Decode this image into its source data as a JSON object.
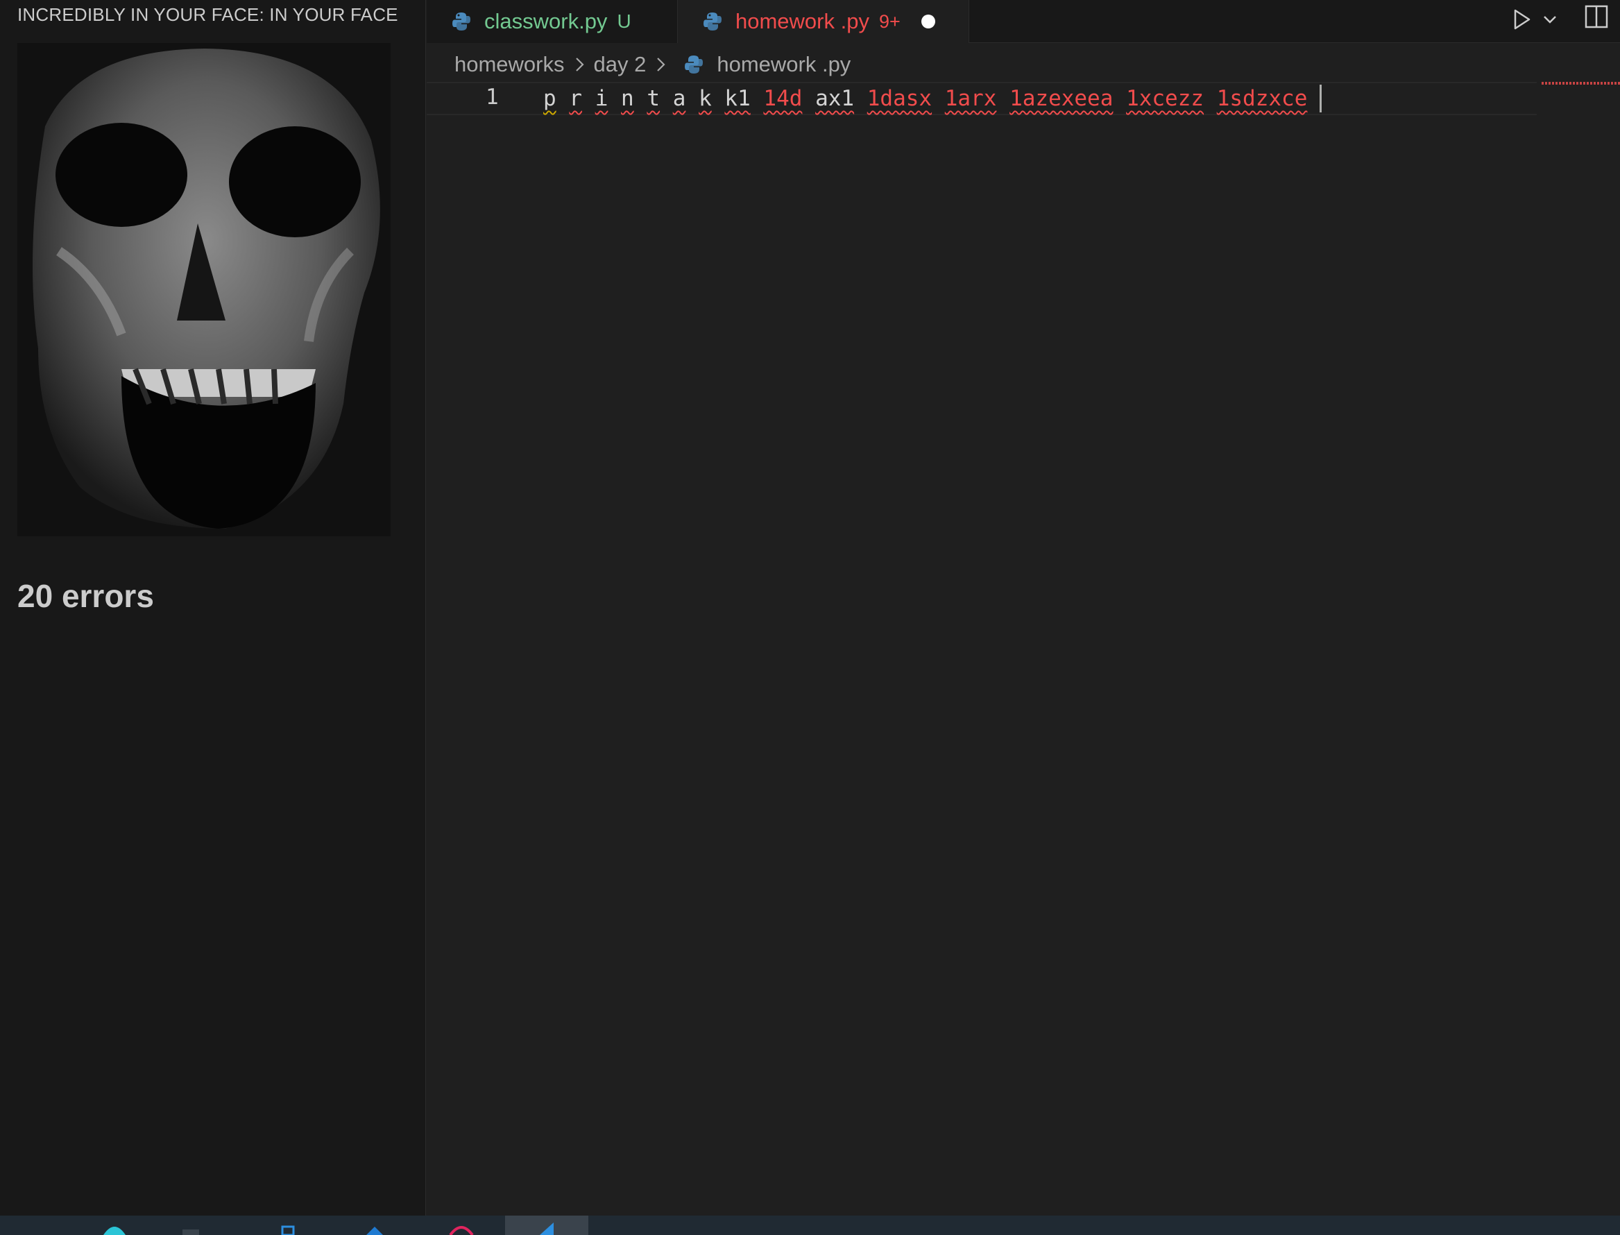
{
  "side_panel": {
    "title": "INCREDIBLY IN YOUR FACE: IN YOUR FACE",
    "image_icon": "skull-image",
    "errors_text": "20 errors"
  },
  "tabs": [
    {
      "label": "classwork.py",
      "badge": "U",
      "icon": "python-icon",
      "state": "inactive"
    },
    {
      "label": "homework .py",
      "badge": "9+",
      "icon": "python-icon",
      "state": "active",
      "dirty": true
    }
  ],
  "toolbar": {
    "run_icon": "play-icon",
    "dropdown_icon": "chevron-down-icon",
    "split_icon": "split-editor-icon"
  },
  "breadcrumb": {
    "items": [
      "homeworks",
      "day 2",
      "homework .py"
    ],
    "separator_icon": "chevron-right-icon"
  },
  "editor": {
    "line_number": "1",
    "tokens": [
      {
        "text": "p",
        "style": "warn"
      },
      {
        "text": "r",
        "style": "white"
      },
      {
        "text": "i",
        "style": "white"
      },
      {
        "text": "n",
        "style": "white"
      },
      {
        "text": "t",
        "style": "white"
      },
      {
        "text": "a",
        "style": "white"
      },
      {
        "text": "k",
        "style": "white"
      },
      {
        "text": "k1",
        "style": "white"
      },
      {
        "text": "14d",
        "style": "red"
      },
      {
        "text": "ax1",
        "style": "white"
      },
      {
        "text": "1dasx",
        "style": "red"
      },
      {
        "text": "1arx",
        "style": "red"
      },
      {
        "text": "1azexeea",
        "style": "red"
      },
      {
        "text": "1xcezz",
        "style": "red"
      },
      {
        "text": "1sdzxce",
        "style": "red"
      }
    ]
  },
  "colors": {
    "background": "#1f1f1f",
    "sidebar": "#181818",
    "error": "#f14c4c",
    "untracked": "#73c991",
    "warning": "#cca700",
    "taskbar": "#202a33"
  }
}
